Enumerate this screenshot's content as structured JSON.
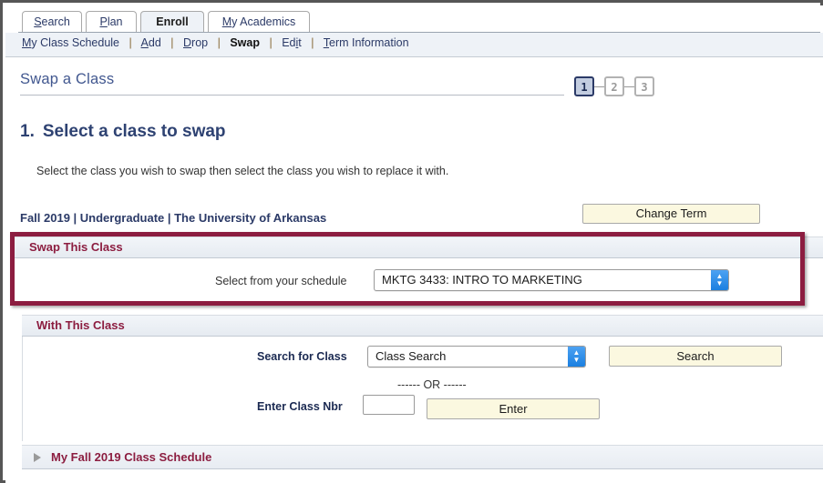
{
  "tabs": [
    {
      "label": "Search",
      "accel": "S",
      "active": false
    },
    {
      "label": "Plan",
      "accel": "P",
      "active": false
    },
    {
      "label": "Enroll",
      "accel": "",
      "active": true
    },
    {
      "label": "My Academics",
      "accel": "M",
      "active": false
    }
  ],
  "subnav": {
    "items": [
      {
        "label": "My Class Schedule",
        "accel": "M",
        "current": false
      },
      {
        "label": "Add",
        "accel": "A",
        "current": false
      },
      {
        "label": "Drop",
        "accel": "D",
        "current": false
      },
      {
        "label": "Swap",
        "accel": "",
        "current": true
      },
      {
        "label": "Edit",
        "accel": "i",
        "current": false
      },
      {
        "label": "Term Information",
        "accel": "T",
        "current": false
      }
    ],
    "separator": "|"
  },
  "page": {
    "title": "Swap a Class",
    "step_number": "1.",
    "step_heading": "Select a class to swap",
    "instruction": "Select the class you wish to swap then select the class you wish to replace it with.",
    "term_line": "Fall 2019 | Undergraduate | The University of Arkansas"
  },
  "steps": [
    {
      "label": "1",
      "state": "done"
    },
    {
      "label": "2",
      "state": "todo"
    },
    {
      "label": "3",
      "state": "todo"
    }
  ],
  "buttons": {
    "change_term": "Change Term",
    "search": "Search",
    "enter": "Enter"
  },
  "swap_section": {
    "header": "Swap This Class",
    "select_label": "Select from your schedule",
    "selected_class": "MKTG 3433: INTRO TO MARKETING"
  },
  "with_section": {
    "header": "With This Class",
    "search_label": "Search for Class",
    "search_option": "Class Search",
    "or_divider": "------ OR ------",
    "class_nbr_label": "Enter Class Nbr",
    "class_nbr_value": "",
    "class_nbr_placeholder": ""
  },
  "schedule_section": {
    "label": "My Fall 2019 Class Schedule",
    "expanded": false
  },
  "colors": {
    "maroon": "#8c1d40",
    "navy": "#2b3a67",
    "title_blue": "#41578f",
    "button_cream": "#fbf8e0",
    "header_bar": "#e9edf3",
    "select_blue": "#1a7fe0",
    "frame_gray": "#565656"
  }
}
